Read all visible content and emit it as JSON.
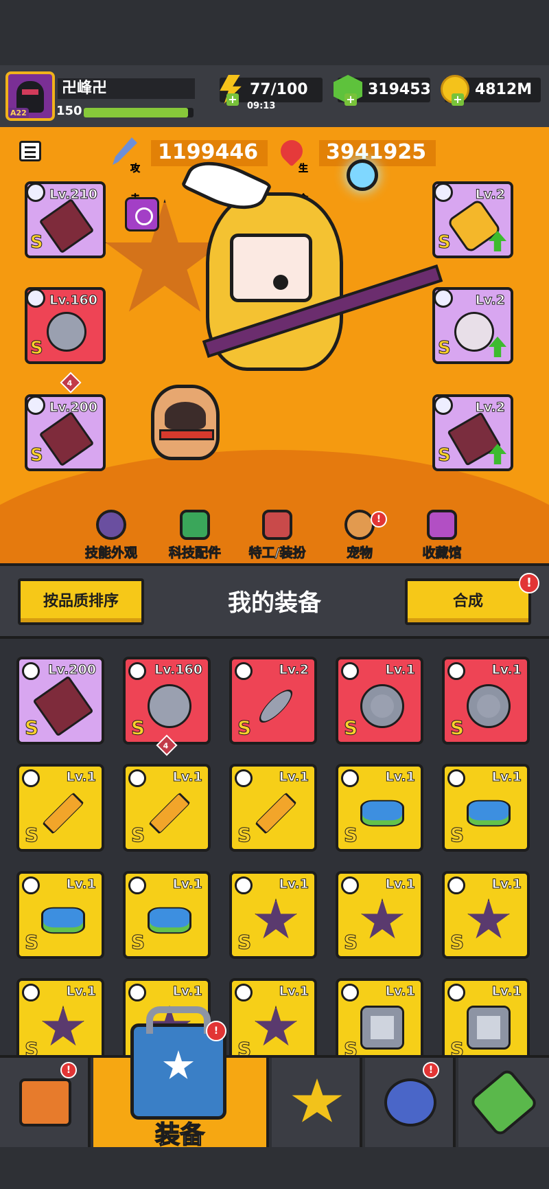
{
  "player": {
    "name": "卍峰卍",
    "level": "150",
    "avatar_badge": "A22",
    "xp_progress": 0.95
  },
  "resources": {
    "energy": "77/100",
    "energy_timer": "09:13",
    "gems": "319453",
    "gold": "4812M",
    "plus": "+"
  },
  "stats": {
    "attack_label": "攻击",
    "attack_value": "1199446",
    "hp_label": "生命",
    "hp_value": "3941925"
  },
  "equipped": {
    "left": [
      {
        "level": "Lv.210",
        "grade": "S",
        "rarity": "purple"
      },
      {
        "level": "Lv.160",
        "grade": "S",
        "rarity": "red",
        "stars": "4"
      },
      {
        "level": "Lv.200",
        "grade": "S",
        "rarity": "purple"
      }
    ],
    "right": [
      {
        "level": "Lv.2",
        "grade": "S",
        "rarity": "purple"
      },
      {
        "level": "Lv.2",
        "grade": "S",
        "rarity": "purple"
      },
      {
        "level": "Lv.2",
        "grade": "S",
        "rarity": "purple"
      }
    ]
  },
  "submenu": [
    {
      "label": "技能外观"
    },
    {
      "label": "科技配件"
    },
    {
      "label": "特工/装扮"
    },
    {
      "label": "宠物",
      "badge": "!"
    },
    {
      "label": "收藏馆"
    }
  ],
  "equipment_panel": {
    "sort_button": "按品质排序",
    "title": "我的装备",
    "merge_button": "合成",
    "merge_badge": "!"
  },
  "inventory": [
    {
      "level": "Lv.200",
      "grade": "S",
      "rarity": "purple",
      "item": "ring"
    },
    {
      "level": "Lv.160",
      "grade": "S",
      "rarity": "red",
      "item": "glove",
      "stars": "4"
    },
    {
      "level": "Lv.2",
      "grade": "S",
      "rarity": "red",
      "item": "sword"
    },
    {
      "level": "Lv.1",
      "grade": "S",
      "rarity": "red",
      "item": "armor"
    },
    {
      "level": "Lv.1",
      "grade": "S",
      "rarity": "red",
      "item": "armor"
    },
    {
      "level": "Lv.1",
      "grade": "S",
      "rarity": "yellow",
      "item": "sword"
    },
    {
      "level": "Lv.1",
      "grade": "S",
      "rarity": "yellow",
      "item": "sword"
    },
    {
      "level": "Lv.1",
      "grade": "S",
      "rarity": "yellow",
      "item": "sword"
    },
    {
      "level": "Lv.1",
      "grade": "S",
      "rarity": "yellow",
      "item": "gun"
    },
    {
      "level": "Lv.1",
      "grade": "S",
      "rarity": "yellow",
      "item": "gun"
    },
    {
      "level": "Lv.1",
      "grade": "S",
      "rarity": "yellow",
      "item": "gun"
    },
    {
      "level": "Lv.1",
      "grade": "S",
      "rarity": "yellow",
      "item": "gun"
    },
    {
      "level": "Lv.1",
      "grade": "S",
      "rarity": "yellow",
      "item": "spike"
    },
    {
      "level": "Lv.1",
      "grade": "S",
      "rarity": "yellow",
      "item": "spike"
    },
    {
      "level": "Lv.1",
      "grade": "S",
      "rarity": "yellow",
      "item": "spike"
    },
    {
      "level": "Lv.1",
      "grade": "S",
      "rarity": "yellow",
      "item": "spike"
    },
    {
      "level": "Lv.1",
      "grade": "S",
      "rarity": "yellow",
      "item": "spike"
    },
    {
      "level": "Lv.1",
      "grade": "S",
      "rarity": "yellow",
      "item": "spike"
    },
    {
      "level": "Lv.1",
      "grade": "S",
      "rarity": "yellow",
      "item": "armor"
    },
    {
      "level": "Lv.1",
      "grade": "S",
      "rarity": "yellow",
      "item": "armor"
    }
  ],
  "nav": {
    "active_label": "装备",
    "badge": "!"
  },
  "colors": {
    "purple": "#d8a6f0",
    "red": "#ee4455",
    "yellow": "#f6cf18",
    "hero_bg": "#f59a10"
  }
}
